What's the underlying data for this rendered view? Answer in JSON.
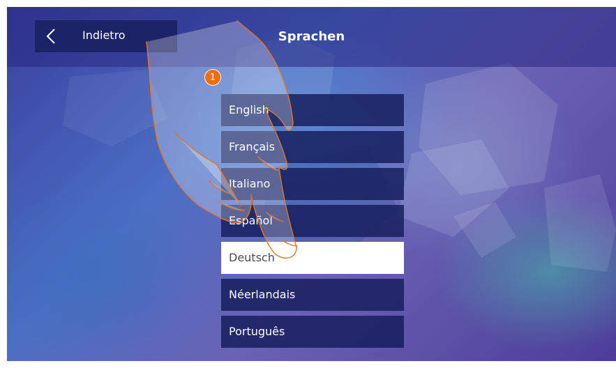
{
  "header": {
    "back_label": "Indietro",
    "title": "Sprachen"
  },
  "languages": [
    {
      "label": "English",
      "selected": false
    },
    {
      "label": "Français",
      "selected": false
    },
    {
      "label": "Italiano",
      "selected": false
    },
    {
      "label": "Español",
      "selected": false
    },
    {
      "label": "Deutsch",
      "selected": true
    },
    {
      "label": "Néerlandais",
      "selected": false
    },
    {
      "label": "Português",
      "selected": false
    }
  ],
  "annotation": {
    "step_number": "1",
    "step_color": "#ee6f12",
    "hand_outline_color": "#e8732a"
  },
  "colors": {
    "header_bar": "#1c2366",
    "item_background": "#141c5a",
    "selected_background": "#ffffff"
  },
  "icons": {
    "back": "chevron-left-icon",
    "pointer": "pointing-hand-icon"
  }
}
